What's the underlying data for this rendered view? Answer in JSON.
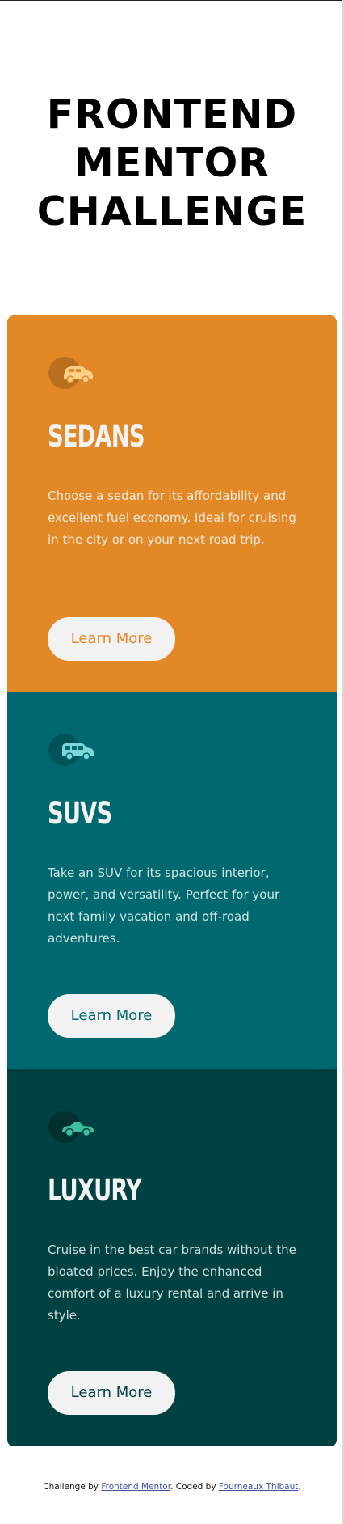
{
  "page": {
    "title": "FRONTEND\nMENTOR\nCHALLENGE"
  },
  "colors": {
    "sedans": "#e38826",
    "suvs": "#006970",
    "luxury": "#004241",
    "button_bg": "#f2f2f2",
    "heading": "#f2f2f2"
  },
  "cards": [
    {
      "icon": "sedan-car-icon",
      "title": "SEDANS",
      "text": "Choose a sedan for its affordability and excellent fuel economy. Ideal for cruising in the city or on your next road trip.",
      "button_label": "Learn More",
      "color": "#e38826"
    },
    {
      "icon": "suv-car-icon",
      "title": "SUVS",
      "text": "Take an SUV for its spacious interior, power, and versatility. Perfect for your next family vacation and off-road adventures.",
      "button_label": "Learn More",
      "color": "#006970"
    },
    {
      "icon": "luxury-car-icon",
      "title": "LUXURY",
      "text": "Cruise in the best car brands without the bloated prices. Enjoy the enhanced comfort of a luxury rental and arrive in style.",
      "button_label": "Learn More",
      "color": "#004241"
    }
  ],
  "footer": {
    "prefix": "Challenge by ",
    "link1": "Frontend Mentor",
    "middle": ". Coded by ",
    "link2": "Fourneaux Thibaut",
    "suffix": "."
  }
}
